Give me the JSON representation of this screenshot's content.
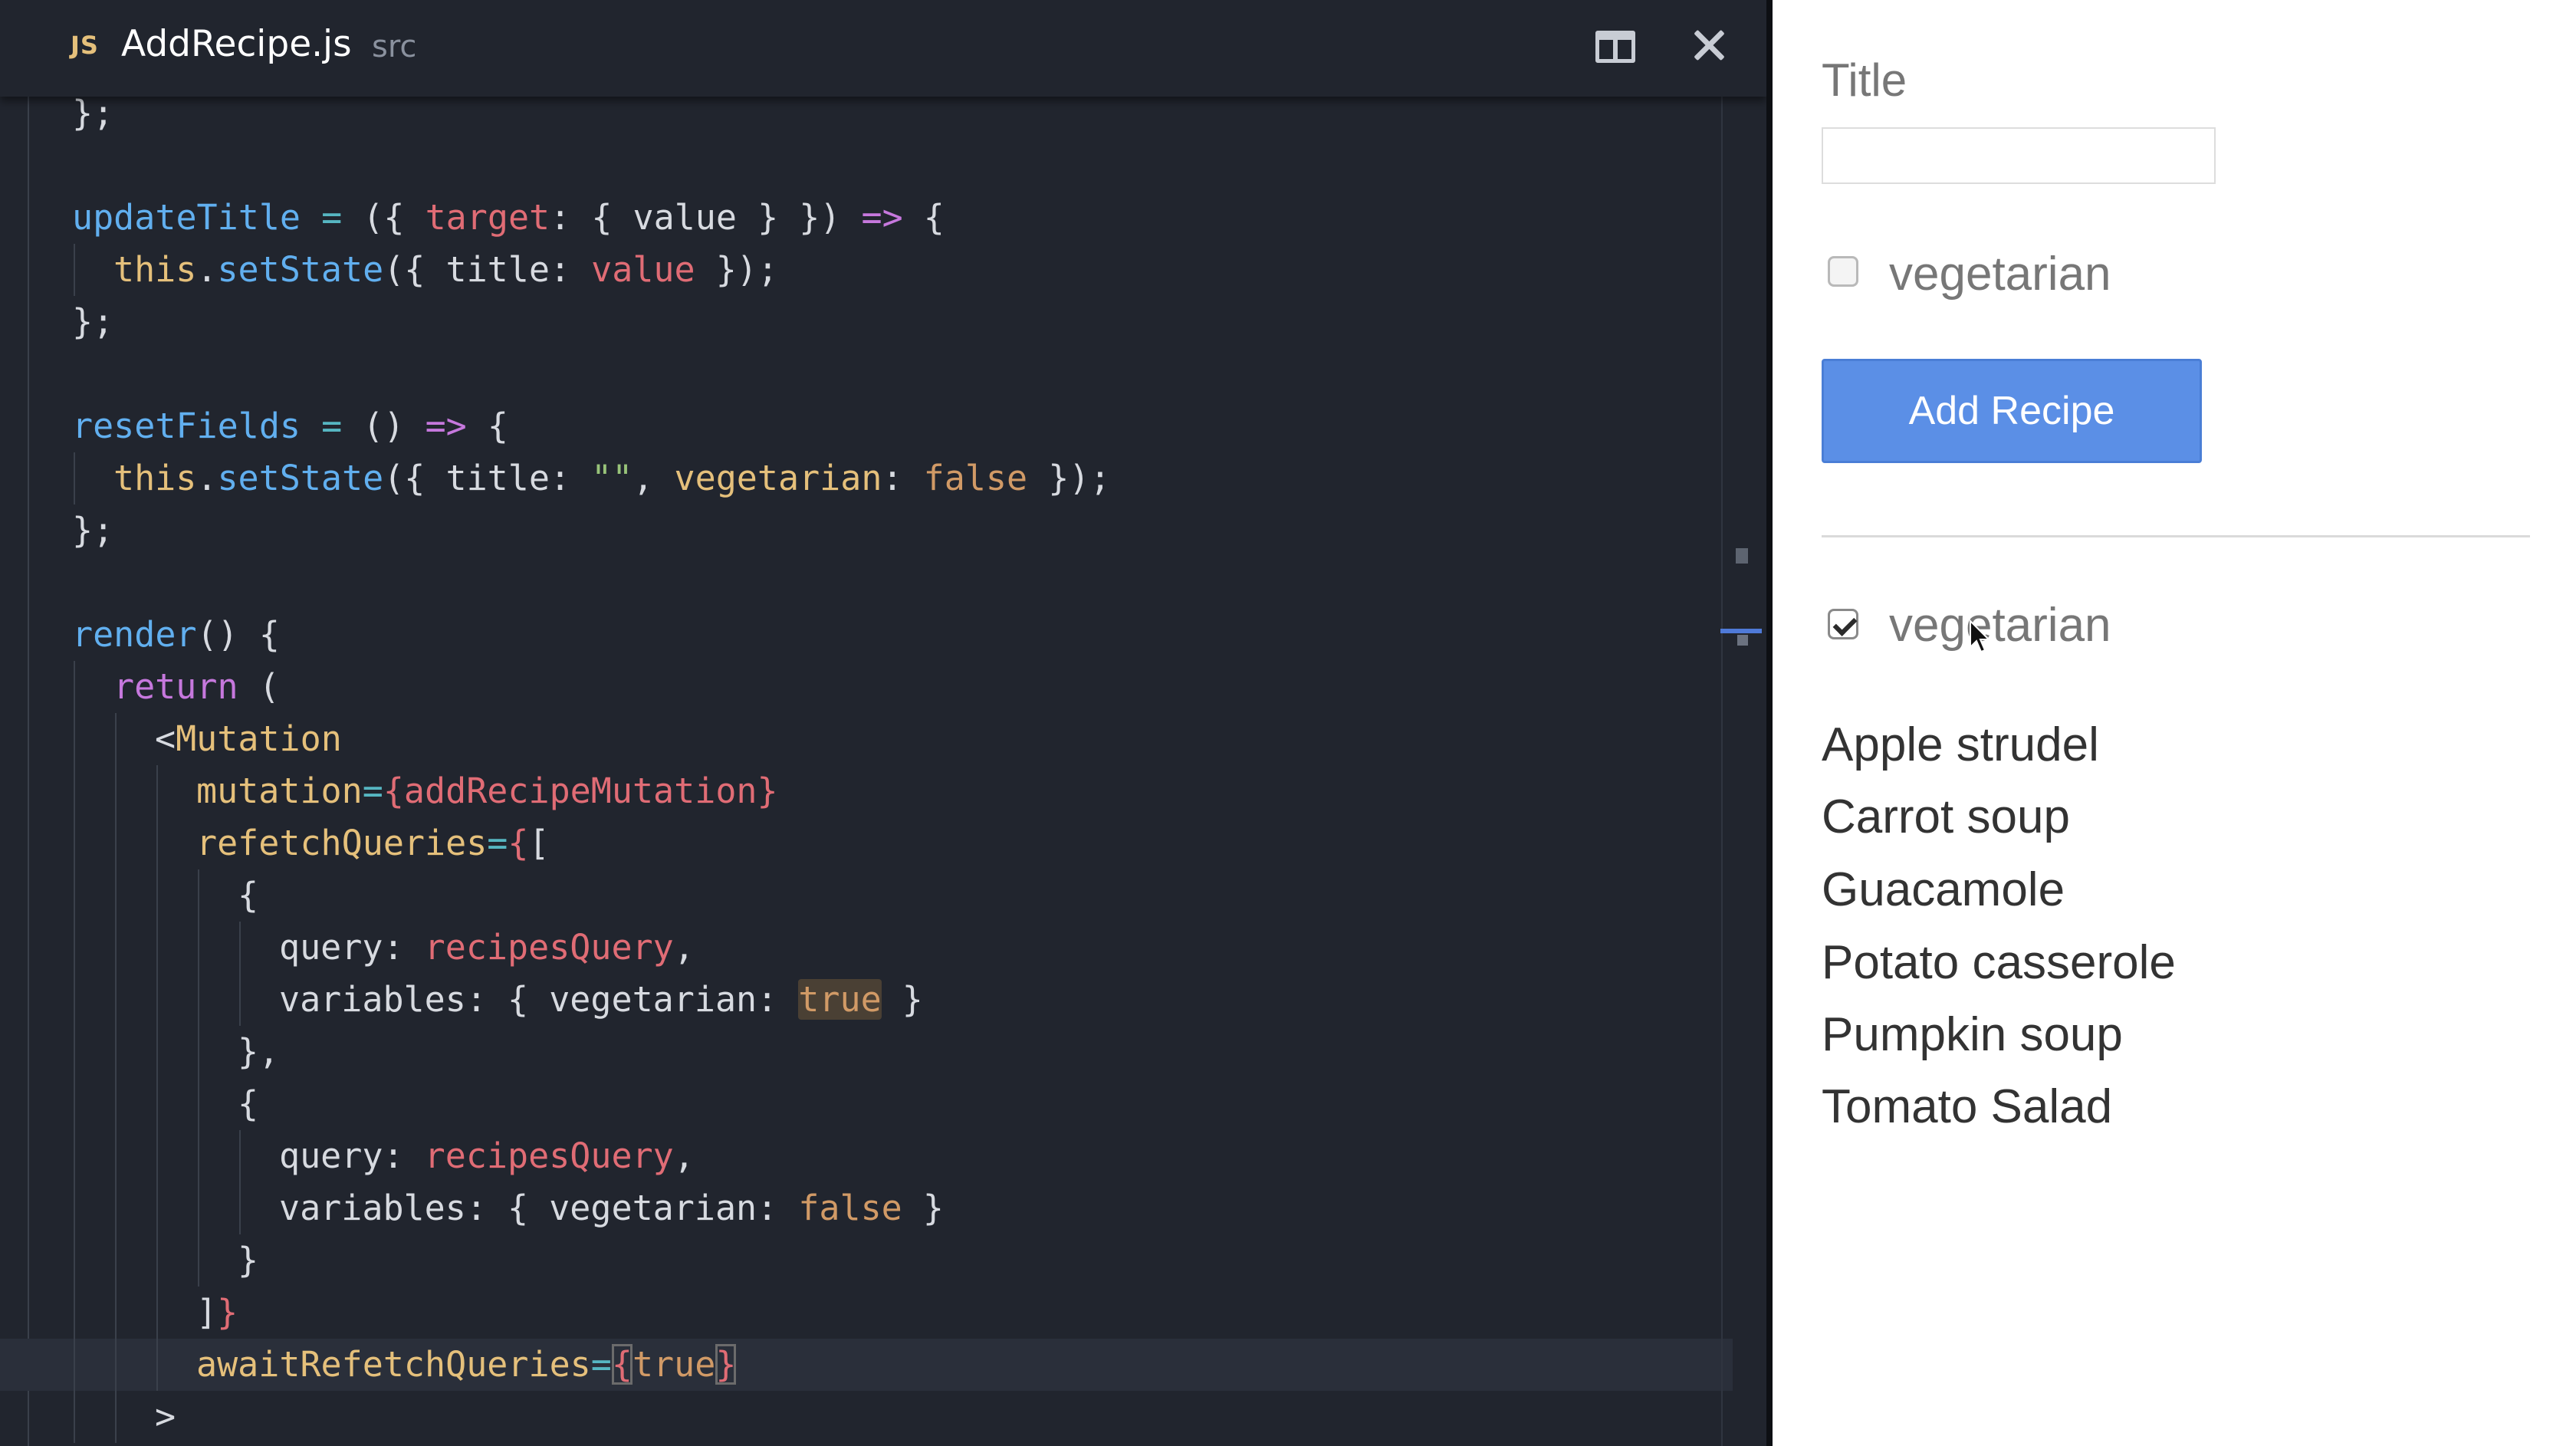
{
  "editor": {
    "tab": {
      "badge": "JS",
      "filename": "AddRecipe.js",
      "directory": "src"
    },
    "lines": [
      {
        "indent": 0,
        "tokens": [
          [
            "punc",
            "};"
          ]
        ]
      },
      {
        "indent": 0,
        "tokens": []
      },
      {
        "indent": 0,
        "tokens": [
          [
            "fn",
            "updateTitle"
          ],
          [
            "op",
            " = "
          ],
          [
            "punc",
            "({ "
          ],
          [
            "prop",
            "target"
          ],
          [
            "punc",
            ": { value } }) "
          ],
          [
            "kw",
            "=>"
          ],
          [
            "punc",
            " {"
          ]
        ]
      },
      {
        "indent": 1,
        "tokens": [
          [
            "obj",
            "this"
          ],
          [
            "punc",
            "."
          ],
          [
            "fn",
            "setState"
          ],
          [
            "punc",
            "({ title: "
          ],
          [
            "prop",
            "value"
          ],
          [
            "punc",
            " });"
          ]
        ]
      },
      {
        "indent": 0,
        "tokens": [
          [
            "punc",
            "};"
          ]
        ]
      },
      {
        "indent": 0,
        "tokens": []
      },
      {
        "indent": 0,
        "tokens": [
          [
            "fn",
            "resetFields"
          ],
          [
            "op",
            " = "
          ],
          [
            "punc",
            "() "
          ],
          [
            "kw",
            "=>"
          ],
          [
            "punc",
            " {"
          ]
        ]
      },
      {
        "indent": 1,
        "tokens": [
          [
            "obj",
            "this"
          ],
          [
            "punc",
            "."
          ],
          [
            "fn",
            "setState"
          ],
          [
            "punc",
            "({ title: "
          ],
          [
            "str",
            "\"\""
          ],
          [
            "punc",
            ", "
          ],
          [
            "attr",
            "vegetarian"
          ],
          [
            "punc",
            ": "
          ],
          [
            "val",
            "false"
          ],
          [
            "punc",
            " });"
          ]
        ]
      },
      {
        "indent": 0,
        "tokens": [
          [
            "punc",
            "};"
          ]
        ]
      },
      {
        "indent": 0,
        "tokens": []
      },
      {
        "indent": 0,
        "tokens": [
          [
            "fn",
            "render"
          ],
          [
            "punc",
            "() {"
          ]
        ]
      },
      {
        "indent": 1,
        "tokens": [
          [
            "kw",
            "return"
          ],
          [
            "punc",
            " ("
          ]
        ]
      },
      {
        "indent": 2,
        "tokens": [
          [
            "punc",
            "<"
          ],
          [
            "attr",
            "Mutation"
          ]
        ]
      },
      {
        "indent": 3,
        "tokens": [
          [
            "attr",
            "mutation"
          ],
          [
            "op",
            "="
          ],
          [
            "jsx",
            "{addRecipeMutation}"
          ]
        ]
      },
      {
        "indent": 3,
        "tokens": [
          [
            "attr",
            "refetchQueries"
          ],
          [
            "op",
            "="
          ],
          [
            "jsx",
            "{"
          ],
          [
            "punc",
            "["
          ]
        ]
      },
      {
        "indent": 4,
        "tokens": [
          [
            "punc",
            "{"
          ]
        ]
      },
      {
        "indent": 5,
        "tokens": [
          [
            "punc",
            "query: "
          ],
          [
            "prop",
            "recipesQuery"
          ],
          [
            "punc",
            ","
          ]
        ]
      },
      {
        "indent": 5,
        "tokens": [
          [
            "punc",
            "variables: { vegetarian: "
          ],
          [
            "val hl",
            "true"
          ],
          [
            "punc",
            " }"
          ]
        ]
      },
      {
        "indent": 4,
        "tokens": [
          [
            "punc",
            "},"
          ]
        ]
      },
      {
        "indent": 4,
        "tokens": [
          [
            "punc",
            "{"
          ]
        ]
      },
      {
        "indent": 5,
        "tokens": [
          [
            "punc",
            "query: "
          ],
          [
            "prop",
            "recipesQuery"
          ],
          [
            "punc",
            ","
          ]
        ]
      },
      {
        "indent": 5,
        "tokens": [
          [
            "punc",
            "variables: { vegetarian: "
          ],
          [
            "val",
            "false"
          ],
          [
            "punc",
            " }"
          ]
        ]
      },
      {
        "indent": 4,
        "tokens": [
          [
            "punc",
            "}"
          ]
        ]
      },
      {
        "indent": 3,
        "tokens": [
          [
            "punc",
            "]"
          ],
          [
            "jsx",
            "}"
          ]
        ]
      },
      {
        "indent": 3,
        "active": true,
        "tokens": [
          [
            "attr",
            "awaitRefetchQueries"
          ],
          [
            "op",
            "="
          ],
          [
            "jsx boxed",
            "{"
          ],
          [
            "val",
            "true"
          ],
          [
            "jsx boxed",
            "}"
          ]
        ]
      },
      {
        "indent": 2,
        "tokens": [
          [
            "punc",
            ">"
          ]
        ]
      }
    ]
  },
  "preview": {
    "title_label": "Title",
    "title_input_value": "",
    "form_vegetarian_label": "vegetarian",
    "form_vegetarian_checked": false,
    "add_button_label": "Add Recipe",
    "filter_vegetarian_label": "vegetarian",
    "filter_vegetarian_checked": true,
    "recipes": [
      "Apple strudel",
      "Carrot soup",
      "Guacamole",
      "Potato casserole",
      "Pumpkin soup",
      "Tomato Salad"
    ],
    "colors": {
      "button": "#5b8fe6",
      "editor_bg": "#21252e"
    }
  }
}
